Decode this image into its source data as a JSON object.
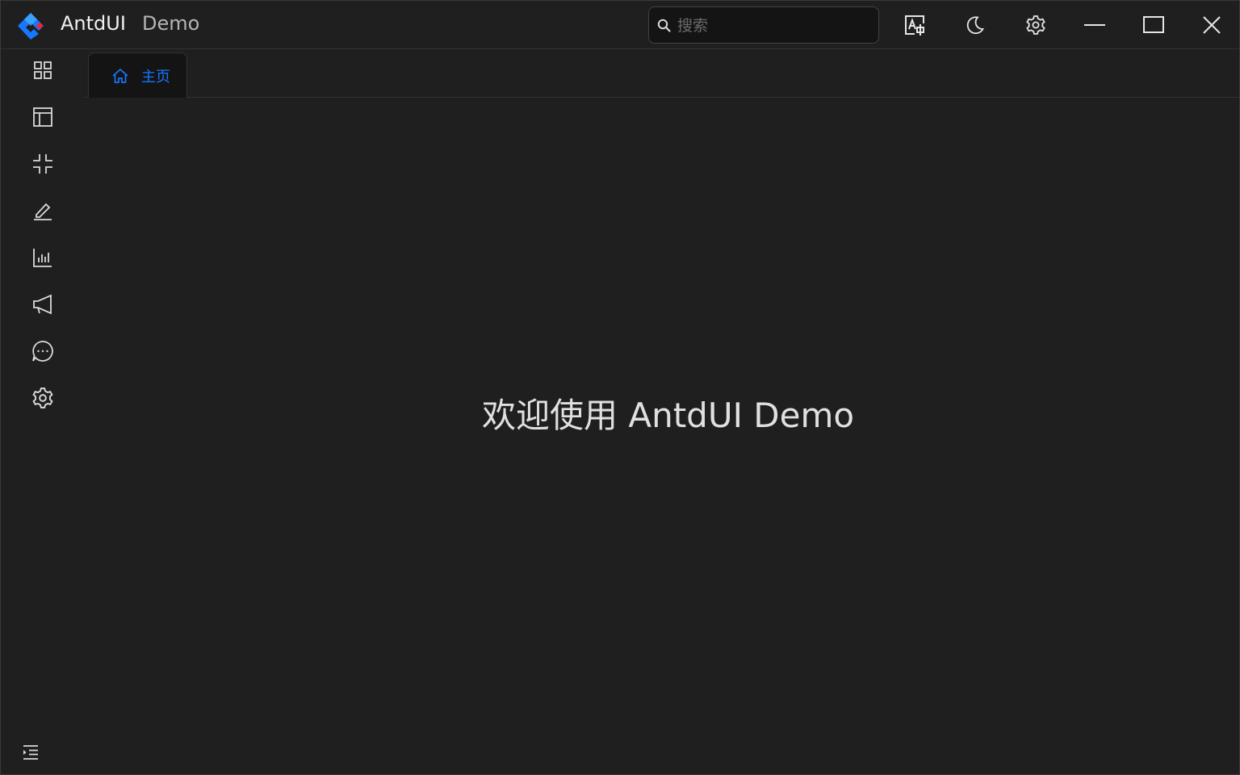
{
  "titlebar": {
    "title": "AntdUI",
    "subtitle": "Demo",
    "search_placeholder": "搜索",
    "buttons": [
      "translate-icon",
      "moon-icon",
      "gear-icon",
      "minimize-icon",
      "maximize-icon",
      "close-icon"
    ]
  },
  "sidebar": {
    "items": [
      {
        "icon": "appstore-icon"
      },
      {
        "icon": "layout-icon"
      },
      {
        "icon": "compress-icon"
      },
      {
        "icon": "edit-icon"
      },
      {
        "icon": "bar-chart-icon"
      },
      {
        "icon": "notification-icon"
      },
      {
        "icon": "message-icon"
      },
      {
        "icon": "setting-icon"
      }
    ],
    "collapse_icon": "menu-indent-icon"
  },
  "tabs": [
    {
      "label": "主页",
      "icon": "home-icon",
      "active": true
    }
  ],
  "content": {
    "welcome_text": "欢迎使用 AntdUI  Demo"
  },
  "colors": {
    "background": "#1f1f1f",
    "accent": "#1677ff",
    "text": "#e6e6e6",
    "border": "#333333"
  }
}
